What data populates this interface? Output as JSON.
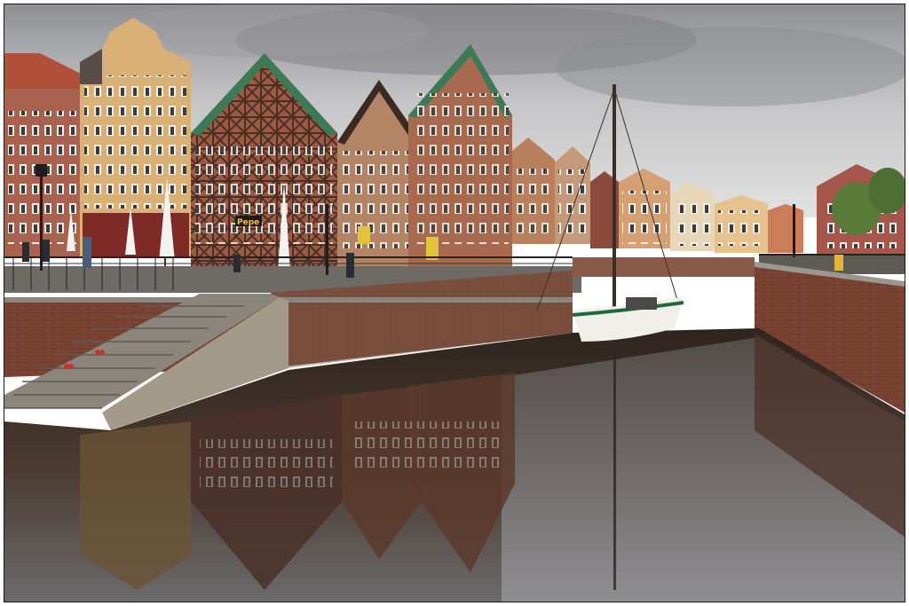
{
  "photo": {
    "scene": "harbour",
    "signs": {
      "cafe_sign": "Pepe"
    },
    "colors": {
      "sky": "#c9c9cb",
      "water": "#3a2f28",
      "brick": "#8a4a38",
      "timber": "#4a2e22",
      "boat_hull": "#f1efe9",
      "boat_stripe": "#1f6a3c"
    }
  }
}
